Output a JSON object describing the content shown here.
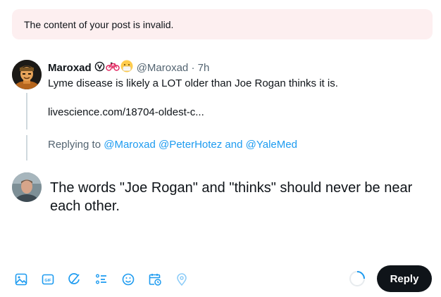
{
  "error_banner": {
    "text": "The content of your post is invalid."
  },
  "quoted_post": {
    "author_name": "Maroxad",
    "badge_icons": [
      "verified-v-icon",
      "bicycle-icon",
      "mask-face-icon"
    ],
    "handle": "@Maroxad",
    "separator": "·",
    "time": "7h",
    "text": "Lyme disease is likely a LOT older than Joe Rogan thinks it is.",
    "link": "livescience.com/18704-oldest-c...",
    "replying_prefix": "Replying to",
    "replying_mentions": [
      "@Maroxad",
      "@PeterHotez"
    ],
    "replying_and": "and",
    "replying_last": "@YaleMed"
  },
  "compose": {
    "text": "The words \"Joe Rogan\" and \"thinks\" should never be near each other."
  },
  "toolbar": {
    "icons": [
      "image-icon",
      "gif-icon",
      "grok-icon",
      "poll-icon",
      "emoji-icon",
      "schedule-icon",
      "location-icon"
    ],
    "gif_label": "GIF"
  },
  "reply_button": {
    "label": "Reply"
  },
  "colors": {
    "accent": "#1d9bf0",
    "error_bg": "#fdeff0",
    "text": "#0f1419",
    "secondary": "#536471",
    "button_bg": "#0f1419"
  }
}
